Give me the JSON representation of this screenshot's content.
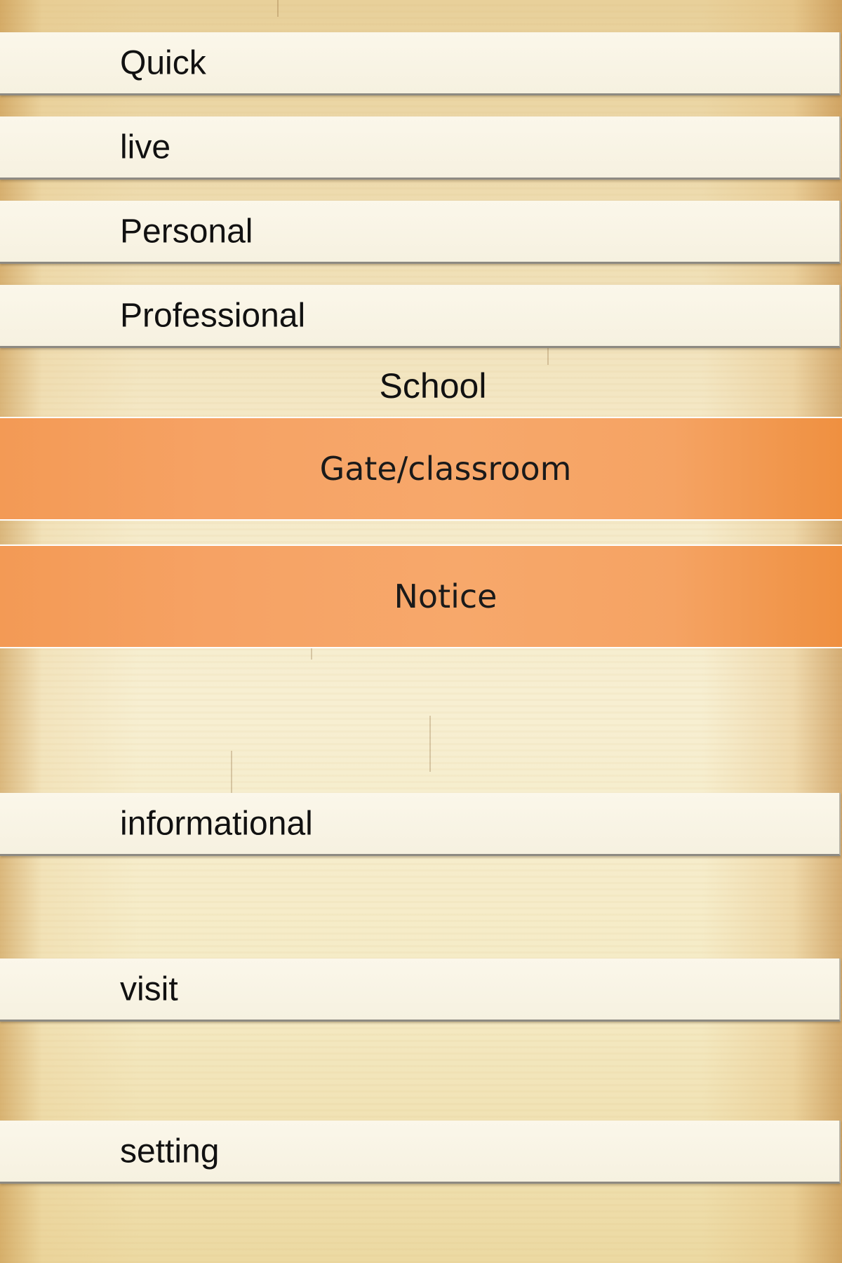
{
  "menu": {
    "quick": "Quick",
    "live": "live",
    "personal": "Personal",
    "professional": "Professional",
    "school_header": "School",
    "gate_classroom": "Gate/classroom",
    "notice": "Notice",
    "informational": "informational",
    "visit": "visit",
    "setting": "setting"
  },
  "colors": {
    "highlight": "#f6a264",
    "row": "#fbf7ea",
    "row_border": "#8d8a82"
  }
}
